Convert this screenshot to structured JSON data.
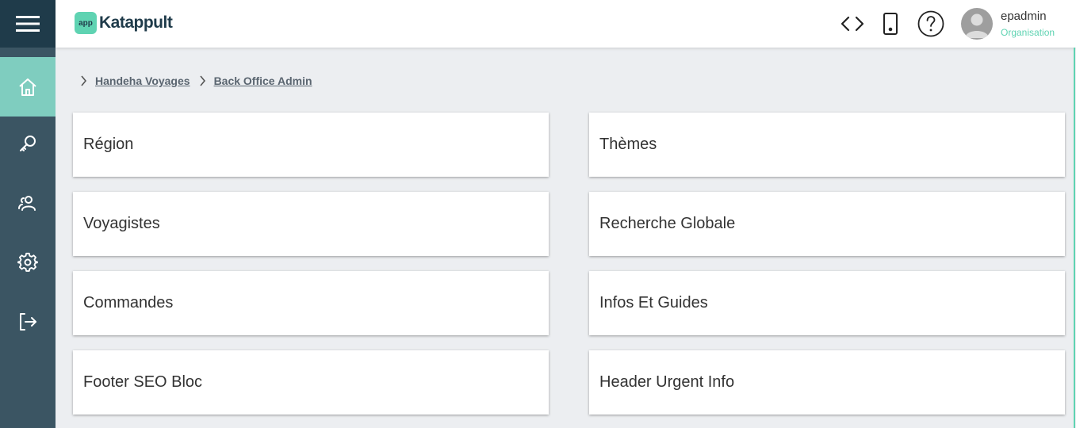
{
  "sidebar": {
    "menu_icon": "hamburger-icon",
    "items": [
      {
        "icon": "home-icon",
        "active": true
      },
      {
        "icon": "key-icon",
        "active": false
      },
      {
        "icon": "users-icon",
        "active": false
      },
      {
        "icon": "gear-icon",
        "active": false
      },
      {
        "icon": "logout-icon",
        "active": false
      }
    ]
  },
  "header": {
    "logo_badge": "app",
    "logo_text": "Katappult",
    "icons": [
      "code-icon",
      "mobile-icon",
      "help-icon"
    ],
    "user": {
      "name": "epadmin",
      "organisation": "Organisation"
    }
  },
  "breadcrumb": [
    "Handeha Voyages",
    "Back Office Admin"
  ],
  "tiles": {
    "left": [
      "Région",
      "Voyagistes",
      "Commandes",
      "Footer SEO Bloc"
    ],
    "right": [
      "Thèmes",
      "Recherche Globale",
      "Infos Et Guides",
      "Header Urgent Info"
    ]
  },
  "colors": {
    "sidebar": "#3b5563",
    "sidebar_top": "#1f3b4a",
    "accent": "#7fcdbf",
    "brand": "#5fd3b2",
    "background": "#eceef1"
  }
}
